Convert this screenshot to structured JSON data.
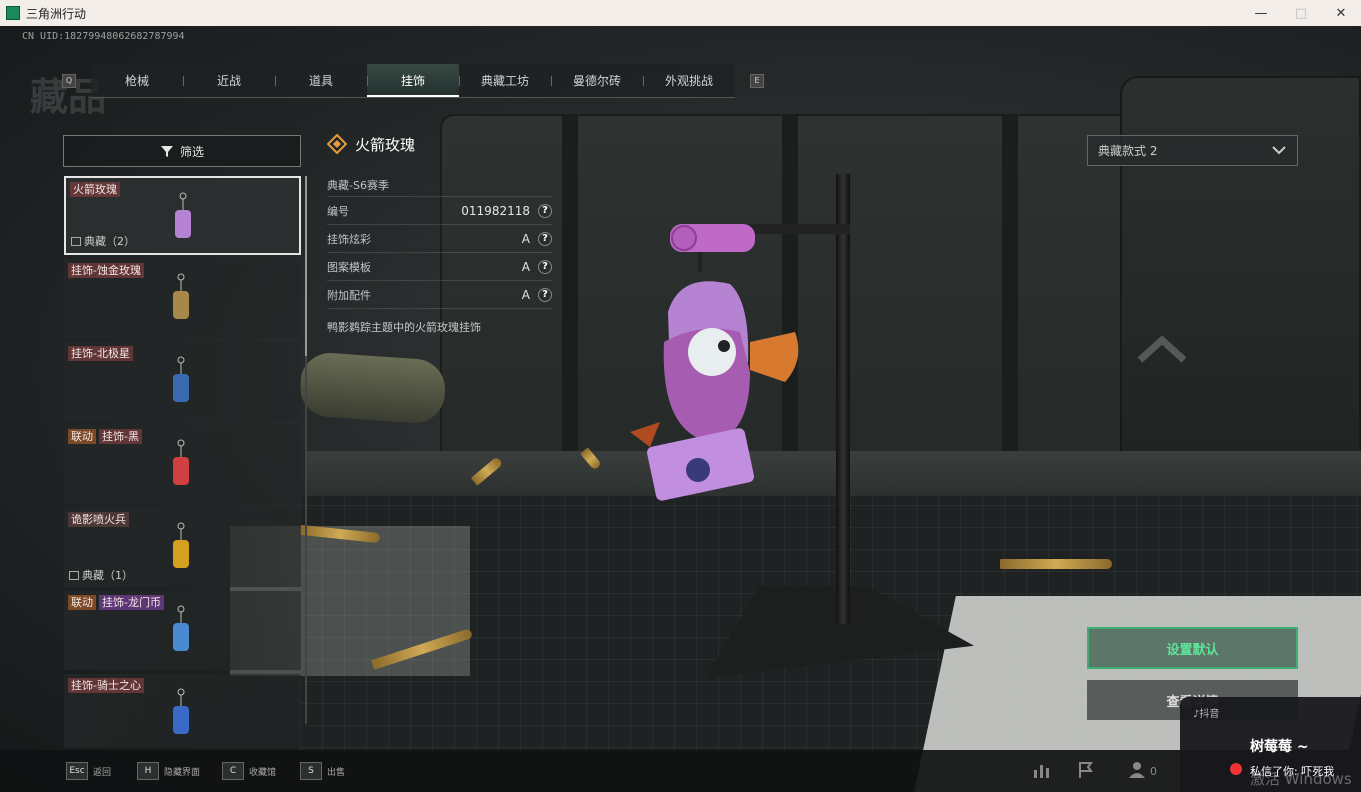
{
  "window": {
    "title": "三角洲行动",
    "minimize": "—",
    "maximize": "□",
    "close": "✕"
  },
  "uid": "CN UID:1827994806268278799​4",
  "page_title": "藏品",
  "tabs": {
    "prev_key": "Q",
    "next_key": "E",
    "items": [
      "枪械",
      "近战",
      "道具",
      "挂饰",
      "典藏工坊",
      "曼德尔砖",
      "外观挑战"
    ],
    "active_index": 3
  },
  "filter": {
    "label": "筛选",
    "icon": "filter-icon"
  },
  "items": [
    {
      "tags": [
        "火箭玫瑰"
      ],
      "rarity": "典藏（2）",
      "selected": true
    },
    {
      "tags": [
        "挂饰-蚀金玫瑰"
      ],
      "rarity": ""
    },
    {
      "tags": [
        "挂饰-北极星"
      ],
      "rarity": ""
    },
    {
      "tags": [
        "联动",
        "挂饰-黑"
      ],
      "rarity": ""
    },
    {
      "tags": [
        "诡影喷火兵"
      ],
      "rarity": "典藏（1）"
    },
    {
      "tags": [
        "联动",
        "挂饰-龙门币"
      ],
      "rarity": ""
    },
    {
      "tags": [
        "挂饰-骑士之心"
      ],
      "rarity": ""
    }
  ],
  "detail": {
    "name": "火箭玫瑰",
    "season": "典藏-S6赛季",
    "rows": [
      {
        "label": "编号",
        "value": "011982118"
      },
      {
        "label": "挂饰炫彩",
        "value": "A"
      },
      {
        "label": "图案模板",
        "value": "A"
      },
      {
        "label": "附加配件",
        "value": "A"
      }
    ],
    "description": "鸭影鹈踪主题中的火箭玫瑰挂饰"
  },
  "style_select": {
    "value": "典藏款式 2"
  },
  "buttons": {
    "set_default": "设置默认",
    "view": "查看详情"
  },
  "bottom_hints": [
    {
      "key": "Esc",
      "label": "返回"
    },
    {
      "key": "H",
      "label": "隐藏界面"
    },
    {
      "key": "C",
      "label": "收藏馆"
    },
    {
      "key": "S",
      "label": "出售"
    }
  ],
  "bottom_right": {
    "friends_count": "0"
  },
  "notification": {
    "app": "抖音",
    "user": "树莓莓 ~",
    "message": "私信了你: 吓死我"
  },
  "watermark": "激活 Windows",
  "colors": {
    "accent_green": "#3fae74",
    "selected_border": "#e6e6e6",
    "tag_brown": "#7a3c3c",
    "tag_purple": "#6e3c8c"
  }
}
